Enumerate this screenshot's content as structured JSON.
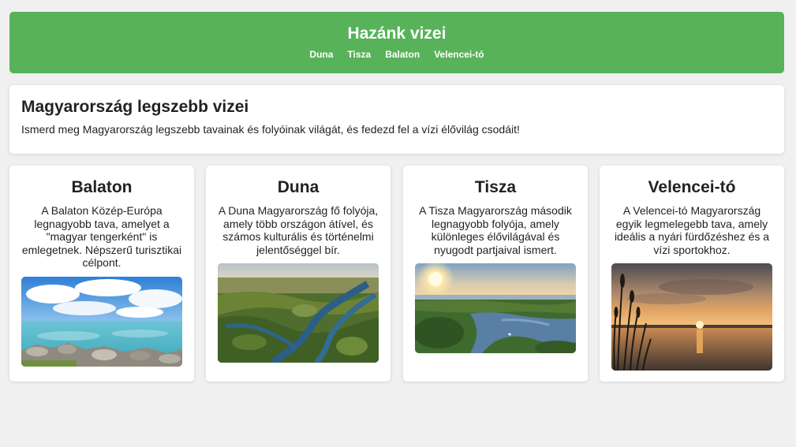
{
  "header": {
    "title": "Hazánk vizei",
    "nav": [
      "Duna",
      "Tisza",
      "Balaton",
      "Velencei-tó"
    ]
  },
  "intro": {
    "title": "Magyarország legszebb vizei",
    "text": "Ismerd meg Magyarország legszebb tavainak és folyóinak világát, és fedezd fel a vízi élővilág csodáit!"
  },
  "cards": [
    {
      "title": "Balaton",
      "text": "A Balaton Közép-Európa legnagyobb tava, amelyet a \"magyar tengerként\" is emlegetnek. Népszerű turisztikai célpont."
    },
    {
      "title": "Duna",
      "text": "A Duna Magyarország fő folyója, amely több országon átível, és számos kulturális és történelmi jelentőséggel bír."
    },
    {
      "title": "Tisza",
      "text": "A Tisza Magyarország második legnagyobb folyója, amely különleges élővilágával és nyugodt partjaival ismert."
    },
    {
      "title": "Velencei-tó",
      "text": "A Velencei-tó Magyarország egyik legmelegebb tava, amely ideális a nyári fürdőzéshez és a vízi sportokhoz."
    }
  ],
  "colors": {
    "header_bg": "#58b25a",
    "page_bg": "#f0f0f0"
  }
}
